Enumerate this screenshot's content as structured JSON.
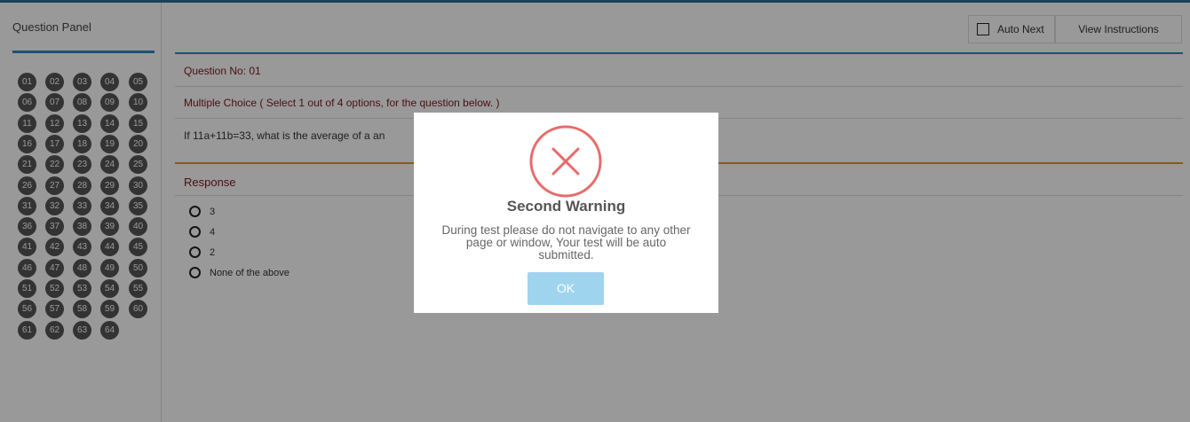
{
  "panel": {
    "title": "Question Panel",
    "questions": [
      "01",
      "02",
      "03",
      "04",
      "05",
      "06",
      "07",
      "08",
      "09",
      "10",
      "11",
      "12",
      "13",
      "14",
      "15",
      "16",
      "17",
      "18",
      "19",
      "20",
      "21",
      "22",
      "23",
      "24",
      "25",
      "26",
      "27",
      "28",
      "29",
      "30",
      "31",
      "32",
      "33",
      "34",
      "35",
      "36",
      "37",
      "38",
      "39",
      "40",
      "41",
      "42",
      "43",
      "44",
      "45",
      "46",
      "47",
      "48",
      "49",
      "50",
      "51",
      "52",
      "53",
      "54",
      "55",
      "56",
      "57",
      "58",
      "59",
      "60",
      "61",
      "62",
      "63",
      "64"
    ]
  },
  "toolbar": {
    "auto_next_label": "Auto Next",
    "auto_next_checked": false,
    "view_instructions_label": "View Instructions"
  },
  "question": {
    "number_label": "Question No: 01",
    "type_label": "Multiple Choice ( Select 1 out of 4 options, for the question below. )",
    "text": "If 11a+11b=33, what is the average of a an"
  },
  "response": {
    "heading": "Response",
    "options": [
      "3",
      "4",
      "2",
      "None of the above"
    ]
  },
  "modal": {
    "icon": "error-x-icon",
    "title": "Second Warning",
    "message": "During test please do not navigate to any other page or window, Your test will be auto submitted.",
    "ok_label": "OK"
  },
  "colors": {
    "accent_blue": "#2a8db8",
    "accent_orange": "#e39a2a",
    "error_red": "#e86b6b",
    "ok_button": "#9fd4ef"
  }
}
